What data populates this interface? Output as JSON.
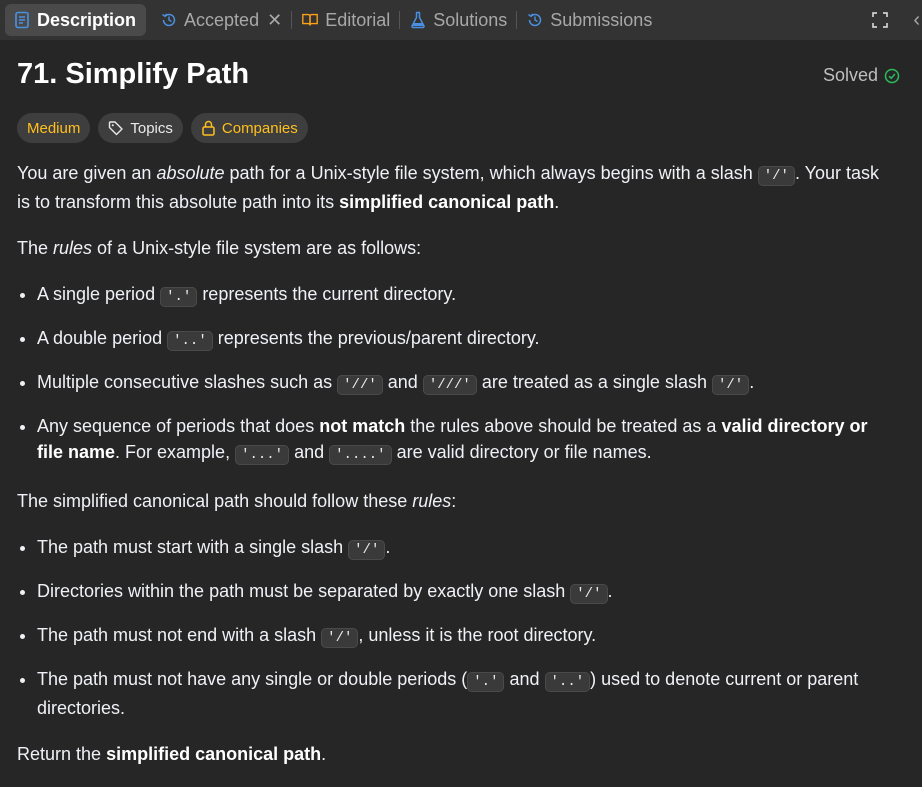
{
  "tabs": {
    "description": "Description",
    "accepted": "Accepted",
    "editorial": "Editorial",
    "solutions": "Solutions",
    "submissions": "Submissions"
  },
  "problem": {
    "title": "71. Simplify Path",
    "status": "Solved",
    "difficulty": "Medium",
    "topics": "Topics",
    "companies": "Companies"
  },
  "colors": {
    "accent_yellow": "#ffc01e",
    "solved_green": "#2cbb5d",
    "tab_blue": "#4a90e2"
  },
  "icons": [
    "description-icon",
    "history-icon",
    "book-icon",
    "flask-icon",
    "history-icon",
    "expand-icon",
    "tag-icon",
    "lock-icon",
    "check-circle-icon"
  ],
  "text": {
    "p1_a": "You are given an ",
    "p1_b": "absolute",
    "p1_c": " path for a Unix-style file system, which always begins with a slash ",
    "p1_code": "'/'",
    "p1_d": ". Your task is to transform this absolute path into its ",
    "p1_e": "simplified canonical path",
    "p1_f": ".",
    "p2_a": "The ",
    "p2_b": "rules",
    "p2_c": " of a Unix-style file system are as follows:",
    "r1_a": "A single period ",
    "r1_code": "'.'",
    "r1_b": " represents the current directory.",
    "r2_a": "A double period ",
    "r2_code": "'..'",
    "r2_b": " represents the previous/parent directory.",
    "r3_a": "Multiple consecutive slashes such as ",
    "r3_code1": "'//'",
    "r3_b": " and ",
    "r3_code2": "'///'",
    "r3_c": " are treated as a single slash ",
    "r3_code3": "'/'",
    "r3_d": ".",
    "r4_a": "Any sequence of periods that does ",
    "r4_b": "not match",
    "r4_c": " the rules above should be treated as a ",
    "r4_d": "valid directory or file name",
    "r4_e": ". For example, ",
    "r4_code1": "'...'",
    "r4_f": " and ",
    "r4_code2": "'....'",
    "r4_g": " are valid directory or file names.",
    "p3_a": "The simplified canonical path should follow these ",
    "p3_b": "rules",
    "p3_c": ":",
    "s1_a": "The path must start with a single slash ",
    "s1_code": "'/'",
    "s1_b": ".",
    "s2_a": "Directories within the path must be separated by exactly one slash ",
    "s2_code": "'/'",
    "s2_b": ".",
    "s3_a": "The path must not end with a slash ",
    "s3_code": "'/'",
    "s3_b": ", unless it is the root directory.",
    "s4_a": "The path must not have any single or double periods (",
    "s4_code1": "'.'",
    "s4_b": " and ",
    "s4_code2": "'..'",
    "s4_c": ") used to denote current or parent directories.",
    "p4_a": "Return the ",
    "p4_b": "simplified canonical path",
    "p4_c": "."
  }
}
